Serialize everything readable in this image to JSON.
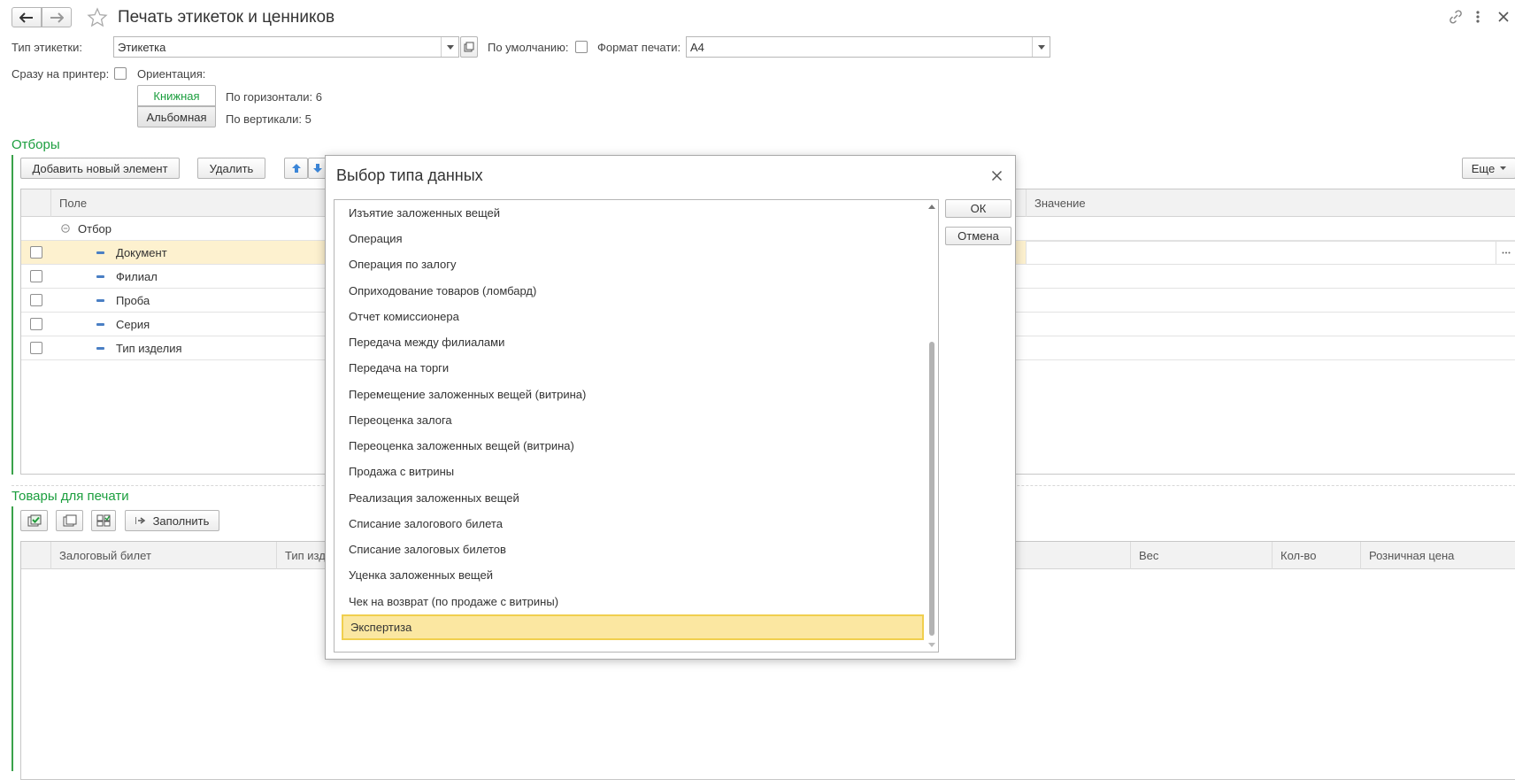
{
  "window": {
    "title": "Печать этикеток и ценников"
  },
  "form": {
    "label_type_label": "Тип этикетки:",
    "label_type_value": "Этикетка",
    "default_label": "По умолчанию:",
    "print_format_label": "Формат печати:",
    "print_format_value": "А4",
    "to_printer_label": "Сразу на принтер:",
    "orientation_label": "Ориентация:",
    "portrait_label": "Книжная",
    "landscape_label": "Альбомная",
    "horizontal_label": "По горизонтали: 6",
    "vertical_label": "По вертикали: 5"
  },
  "filters": {
    "title": "Отборы",
    "add_button": "Добавить новый элемент",
    "delete_button": "Удалить",
    "more_button": "Еще",
    "col_field": "Поле",
    "col_value": "Значение",
    "group_label": "Отбор",
    "rows": [
      "Документ",
      "Филиал",
      "Проба",
      "Серия",
      "Тип изделия"
    ]
  },
  "goods": {
    "title": "Товары для печати",
    "fill_button": "Заполнить",
    "col_ticket": "Залоговый билет",
    "col_type": "Тип изд",
    "col_weight": "Вес",
    "col_qty": "Кол-во",
    "col_price": "Розничная цена"
  },
  "dialog": {
    "title": "Выбор типа данных",
    "ok_button": "ОК",
    "cancel_button": "Отмена",
    "items": [
      "Изъятие заложенных вещей",
      "Операция",
      "Операция по залогу",
      "Оприходование товаров (ломбард)",
      "Отчет комиссионера",
      "Передача между филиалами",
      "Передача на торги",
      "Перемещение заложенных вещей (витрина)",
      "Переоценка залога",
      "Переоценка заложенных вещей (витрина)",
      "Продажа с витрины",
      "Реализация заложенных вещей",
      "Списание залогового билета",
      "Списание залоговых билетов",
      "Уценка заложенных вещей",
      "Чек на возврат (по продаже с витрины)",
      "Экспертиза"
    ],
    "selected_item": "Экспертиза"
  },
  "icons": {
    "back": "arrow-left-icon",
    "forward": "arrow-right-icon",
    "favorite": "star-icon",
    "link": "link-icon",
    "menu": "more-vertical-icon",
    "close": "close-icon"
  },
  "colors": {
    "accent_green": "#1b9e3e",
    "selection_fill": "#fbe7a1",
    "selection_border": "#f0cf4e",
    "row_highlight": "#fdf1cf"
  }
}
